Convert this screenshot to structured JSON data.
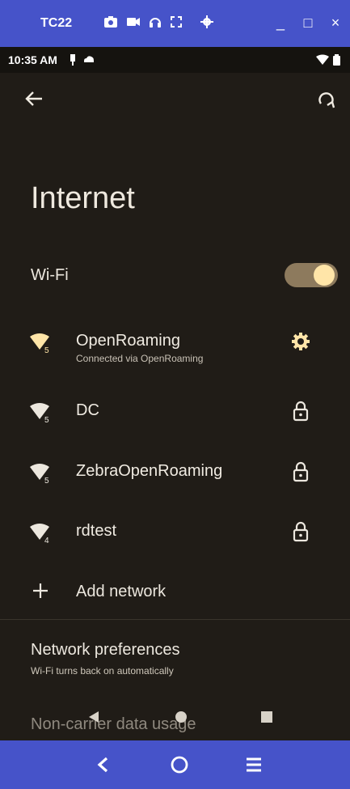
{
  "emulator": {
    "title": "TC22",
    "window_controls": [
      "_",
      "□",
      "×"
    ]
  },
  "status_bar": {
    "time": "10:35 AM"
  },
  "page": {
    "title": "Internet"
  },
  "wifi": {
    "label": "Wi-Fi",
    "enabled": true
  },
  "networks": [
    {
      "name": "OpenRoaming",
      "status": "Connected via OpenRoaming",
      "badge": "5",
      "trailing_icon": "gear-icon",
      "connected": true
    },
    {
      "name": "DC",
      "badge": "5",
      "trailing_icon": "lock-icon"
    },
    {
      "name": "ZebraOpenRoaming",
      "badge": "5",
      "trailing_icon": "lock-icon"
    },
    {
      "name": "rdtest",
      "badge": "4",
      "trailing_icon": "lock-icon"
    }
  ],
  "add_network": {
    "label": "Add network"
  },
  "preferences": {
    "title": "Network preferences",
    "subtitle": "Wi-Fi turns back on automatically"
  },
  "data_usage": {
    "label": "Non-carrier data usage"
  },
  "colors": {
    "accent": "#ffe5a8",
    "background": "#201c17",
    "emulator_bar": "#4653c9"
  }
}
